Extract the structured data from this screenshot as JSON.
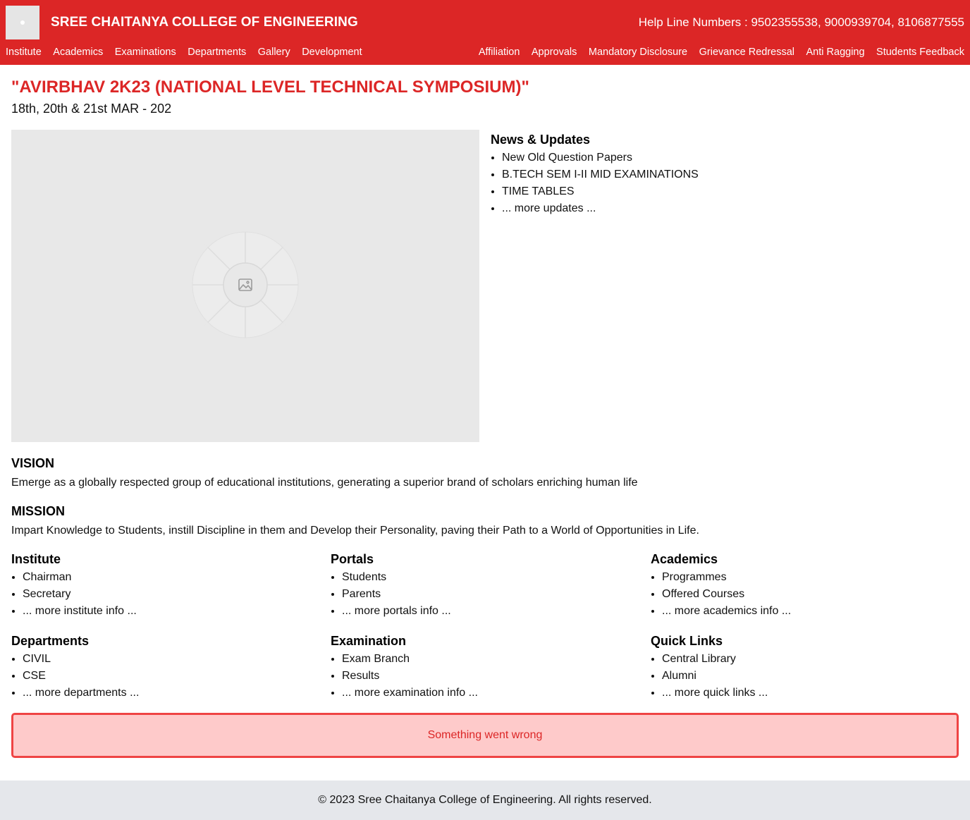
{
  "header": {
    "college_name": "SREE CHAITANYA COLLEGE OF ENGINEERING",
    "helpline": "Help Line Numbers : 9502355538, 9000939704, 8106877555",
    "nav_left": [
      "Institute",
      "Academics",
      "Examinations",
      "Departments",
      "Gallery",
      "Development"
    ],
    "nav_right": [
      "Affiliation",
      "Approvals",
      "Mandatory Disclosure",
      "Grievance Redressal",
      "Anti Ragging",
      "Students Feedback"
    ]
  },
  "event": {
    "title": "\"AVIRBHAV 2K23 (NATIONAL LEVEL TECHNICAL SYMPOSIUM)\"",
    "date": "18th, 20th & 21st MAR - 202"
  },
  "news": {
    "heading": "News & Updates",
    "items": [
      "New Old Question Papers",
      "B.TECH SEM I-II MID EXAMINATIONS",
      "TIME TABLES",
      "... more updates ..."
    ]
  },
  "vision": {
    "heading": "VISION",
    "text": "Emerge as a globally respected group of educational institutions, generating a superior brand of scholars enriching human life"
  },
  "mission": {
    "heading": "MISSION",
    "text": "Impart Knowledge to Students, instill Discipline in them and Develop their Personality, paving their Path to a World of Opportunities in Life."
  },
  "sections": [
    {
      "heading": "Institute",
      "items": [
        "Chairman",
        "Secretary",
        "... more institute info ..."
      ]
    },
    {
      "heading": "Portals",
      "items": [
        "Students",
        "Parents",
        "... more portals info ..."
      ]
    },
    {
      "heading": "Academics",
      "items": [
        "Programmes",
        "Offered Courses",
        "... more academics info ..."
      ]
    },
    {
      "heading": "Departments",
      "items": [
        "CIVIL",
        "CSE",
        "... more departments ..."
      ]
    },
    {
      "heading": "Examination",
      "items": [
        "Exam Branch",
        "Results",
        "... more examination info ..."
      ]
    },
    {
      "heading": "Quick Links",
      "items": [
        "Central Library",
        "Alumni",
        "... more quick links ..."
      ]
    }
  ],
  "error": {
    "message": "Something went wrong"
  },
  "footer": {
    "text": "© 2023 Sree Chaitanya College of Engineering. All rights reserved."
  },
  "colors": {
    "brand": "#dc2626",
    "error_bg": "#fecaca",
    "error_border": "#ef4444",
    "footer_bg": "#e5e7eb"
  },
  "icons": {
    "banner_placeholder": "image-icon"
  }
}
